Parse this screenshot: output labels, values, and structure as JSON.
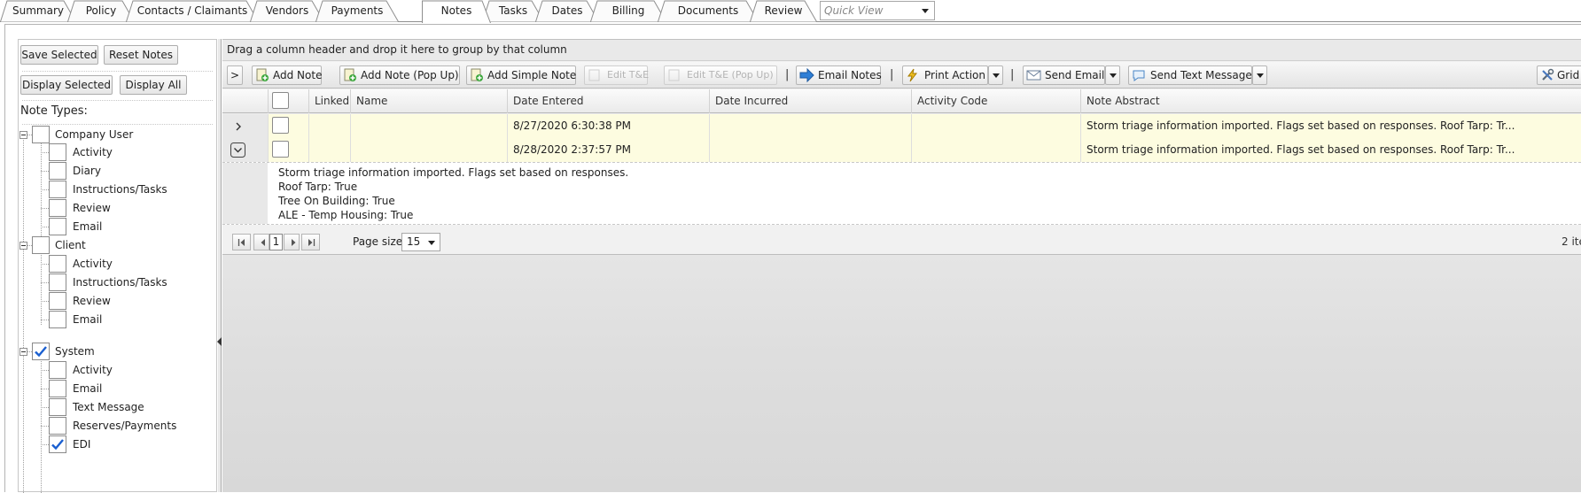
{
  "tabs": [
    {
      "label": "Summary",
      "active": false
    },
    {
      "label": "Policy",
      "active": false
    },
    {
      "label": "Contacts / Claimants",
      "active": false
    },
    {
      "label": "Vendors",
      "active": false
    },
    {
      "label": "Payments",
      "active": false
    },
    {
      "label": "Notes",
      "active": true
    },
    {
      "label": "Tasks",
      "active": false
    },
    {
      "label": "Dates",
      "active": false
    },
    {
      "label": "Billing",
      "active": false
    },
    {
      "label": "Documents",
      "active": false
    },
    {
      "label": "Review",
      "active": false
    }
  ],
  "quick_view": {
    "placeholder": "Quick View"
  },
  "left_panel": {
    "save_selected": "Save Selected",
    "reset_notes": "Reset Notes",
    "display_selected": "Display Selected",
    "display_all": "Display All",
    "note_types_label": "Note Types:",
    "groups": [
      {
        "label": "Company User",
        "checked": false,
        "children": [
          {
            "label": "Activity",
            "checked": false
          },
          {
            "label": "Diary",
            "checked": false
          },
          {
            "label": "Instructions/Tasks",
            "checked": false
          },
          {
            "label": "Review",
            "checked": false
          },
          {
            "label": "Email",
            "checked": false
          }
        ]
      },
      {
        "label": "Client",
        "checked": false,
        "children": [
          {
            "label": "Activity",
            "checked": false
          },
          {
            "label": "Instructions/Tasks",
            "checked": false
          },
          {
            "label": "Review",
            "checked": false
          },
          {
            "label": "Email",
            "checked": false
          }
        ]
      },
      {
        "label": "System",
        "checked": true,
        "children": [
          {
            "label": "Activity",
            "checked": false
          },
          {
            "label": "Email",
            "checked": false
          },
          {
            "label": "Text Message",
            "checked": false
          },
          {
            "label": "Reserves/Payments",
            "checked": false
          },
          {
            "label": "EDI",
            "checked": true
          }
        ]
      }
    ]
  },
  "grid": {
    "group_hint": "Drag a column header and drop it here to group by that column",
    "toolbar": {
      "expand": ">",
      "add_note": "Add Note",
      "add_note_popup": "Add Note (Pop Up)",
      "add_simple_note": "Add Simple Note",
      "edit_te": "Edit T&E",
      "edit_te_popup": "Edit T&E (Pop Up)",
      "email_notes": "Email Notes",
      "print_action": "Print Action",
      "send_email": "Send Email",
      "send_text": "Send Text Message",
      "grid": "Grid",
      "separator": "|"
    },
    "columns": {
      "linked": "Linked",
      "name": "Name",
      "date_entered": "Date Entered",
      "date_incurred": "Date Incurred",
      "activity_code": "Activity Code",
      "note_abstract": "Note Abstract"
    },
    "rows": [
      {
        "expanded": false,
        "linked": "",
        "name": "",
        "date_entered": "8/27/2020 6:30:38 PM",
        "date_incurred": "",
        "activity_code": "",
        "note_abstract": "Storm triage information imported. Flags set based on responses. Roof Tarp: Tr..."
      },
      {
        "expanded": true,
        "linked": "",
        "name": "",
        "date_entered": "8/28/2020 2:37:57 PM",
        "date_incurred": "",
        "activity_code": "",
        "note_abstract": "Storm triage information imported. Flags set based on responses. Roof Tarp: Tr..."
      }
    ],
    "detail_lines": [
      "Storm triage information imported. Flags set based on responses.",
      "Roof Tarp: True",
      "Tree On Building: True",
      "ALE - Temp Housing: True"
    ],
    "pager": {
      "current_page": "1",
      "page_size_label": "Page size:",
      "page_size": "15",
      "items_text": "2 ite"
    }
  }
}
